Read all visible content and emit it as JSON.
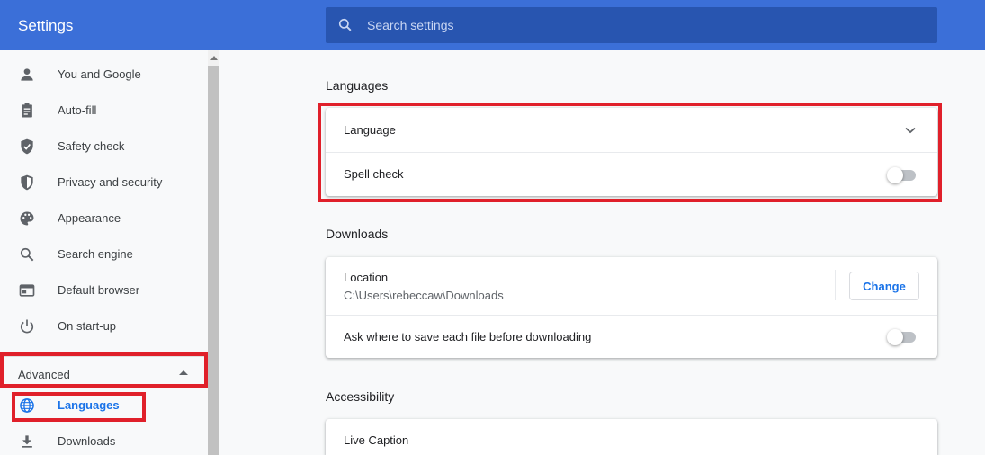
{
  "header": {
    "title": "Settings",
    "search_placeholder": "Search settings"
  },
  "sidebar": {
    "items": [
      {
        "label": "You and Google",
        "icon": "person-icon"
      },
      {
        "label": "Auto-fill",
        "icon": "clipboard-icon"
      },
      {
        "label": "Safety check",
        "icon": "shield-check-icon"
      },
      {
        "label": "Privacy and security",
        "icon": "shield-icon"
      },
      {
        "label": "Appearance",
        "icon": "palette-icon"
      },
      {
        "label": "Search engine",
        "icon": "search-icon"
      },
      {
        "label": "Default browser",
        "icon": "browser-icon"
      },
      {
        "label": "On start-up",
        "icon": "power-icon"
      }
    ],
    "advanced_label": "Advanced",
    "advanced_items": [
      {
        "label": "Languages",
        "icon": "globe-icon",
        "active": true
      },
      {
        "label": "Downloads",
        "icon": "download-icon"
      }
    ]
  },
  "languages": {
    "title": "Languages",
    "language_label": "Language",
    "spell_check_label": "Spell check",
    "spell_check_enabled": false
  },
  "downloads": {
    "title": "Downloads",
    "location_label": "Location",
    "location_value": "C:\\Users\\rebeccaw\\Downloads",
    "change_label": "Change",
    "ask_label": "Ask where to save each file before downloading",
    "ask_enabled": false
  },
  "accessibility": {
    "title": "Accessibility",
    "live_caption_label": "Live Caption"
  },
  "colors": {
    "header": "#3b6fd8",
    "search": "#2855b0",
    "accent": "#1a73e8",
    "highlight": "#e0202a"
  }
}
